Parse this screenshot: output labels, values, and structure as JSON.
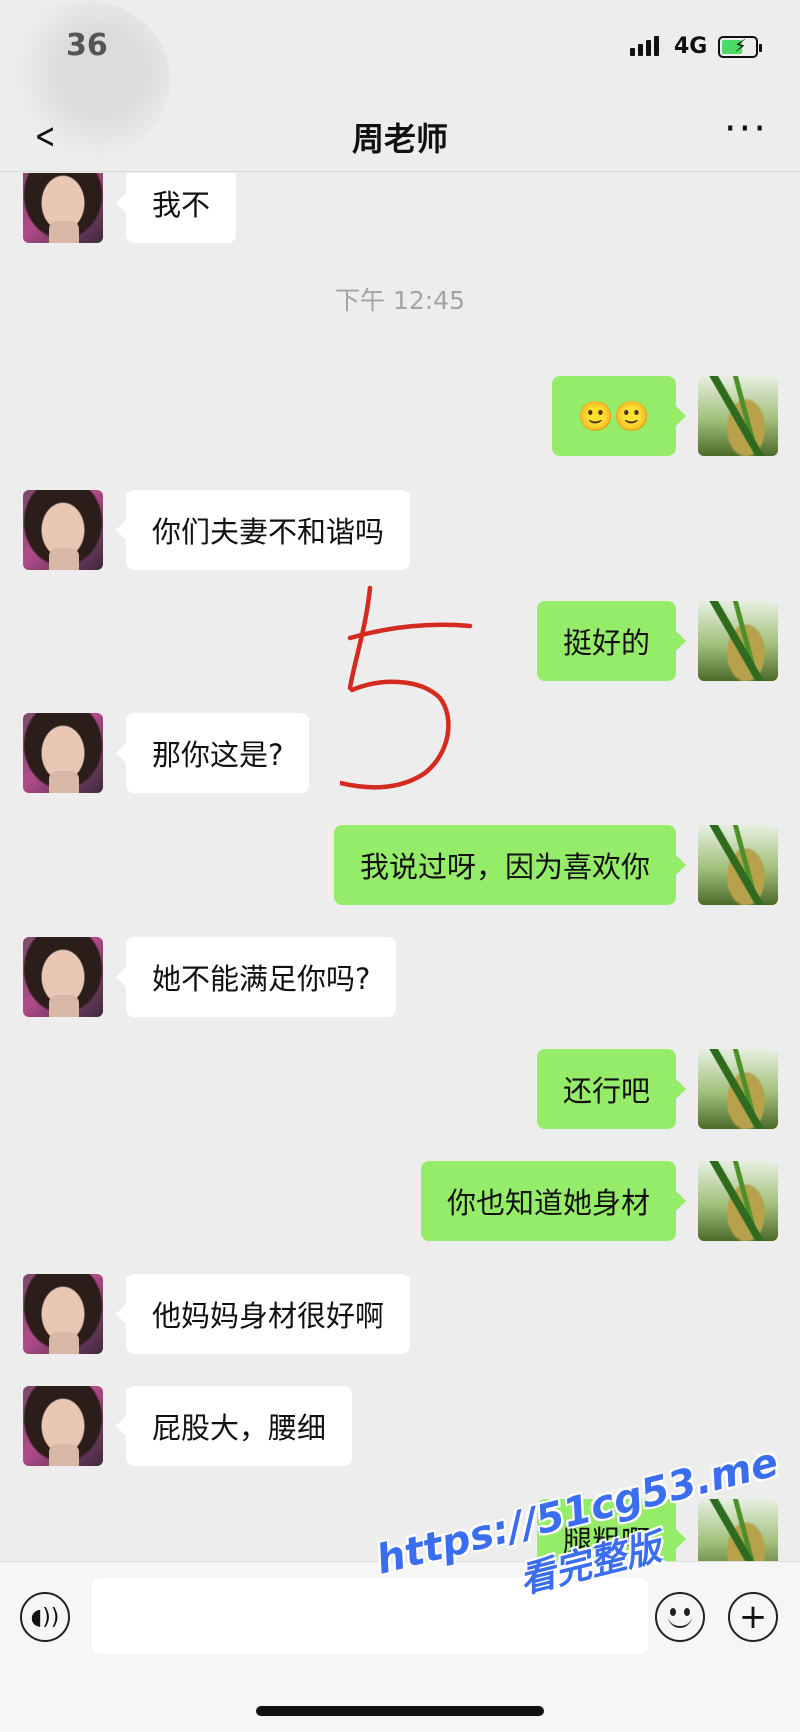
{
  "status_bar": {
    "time": "36",
    "network": "4G",
    "battery_icon": "battery-charging-icon"
  },
  "header": {
    "title": "周老师",
    "back_icon": "chevron-left-icon",
    "more_icon": "more-dots-icon"
  },
  "messages": [
    {
      "side": "left",
      "text": "我不"
    },
    {
      "type": "timestamp",
      "text": "下午 12:45"
    },
    {
      "side": "right",
      "text": "🙂🙂",
      "note": "emoji"
    },
    {
      "side": "left",
      "text": "你们夫妻不和谐吗"
    },
    {
      "side": "right",
      "text": "挺好的"
    },
    {
      "side": "left",
      "text": "那你这是?"
    },
    {
      "side": "right",
      "text": "我说过呀，因为喜欢你"
    },
    {
      "side": "left",
      "text": "她不能满足你吗?"
    },
    {
      "side": "right",
      "text": "还行吧"
    },
    {
      "side": "right",
      "text": "你也知道她身材"
    },
    {
      "side": "left",
      "text": "他妈妈身材很好啊"
    },
    {
      "side": "left",
      "text": "屁股大，腰细"
    },
    {
      "side": "right",
      "text": "腿粗啊"
    }
  ],
  "annotation": {
    "text": "5",
    "color": "#d42a1f"
  },
  "input_bar": {
    "voice_icon": "voice-icon",
    "text_value": "",
    "emoji_icon": "emoji-icon",
    "add_icon": "plus-icon"
  },
  "watermark": {
    "url": "https://51cg53.me",
    "sub": "看完整版",
    "color": "#3a6df0"
  },
  "colors": {
    "background": "#ededed",
    "bubble_self": "#95ec69",
    "bubble_other": "#ffffff",
    "timestamp": "#a3a3a3"
  }
}
